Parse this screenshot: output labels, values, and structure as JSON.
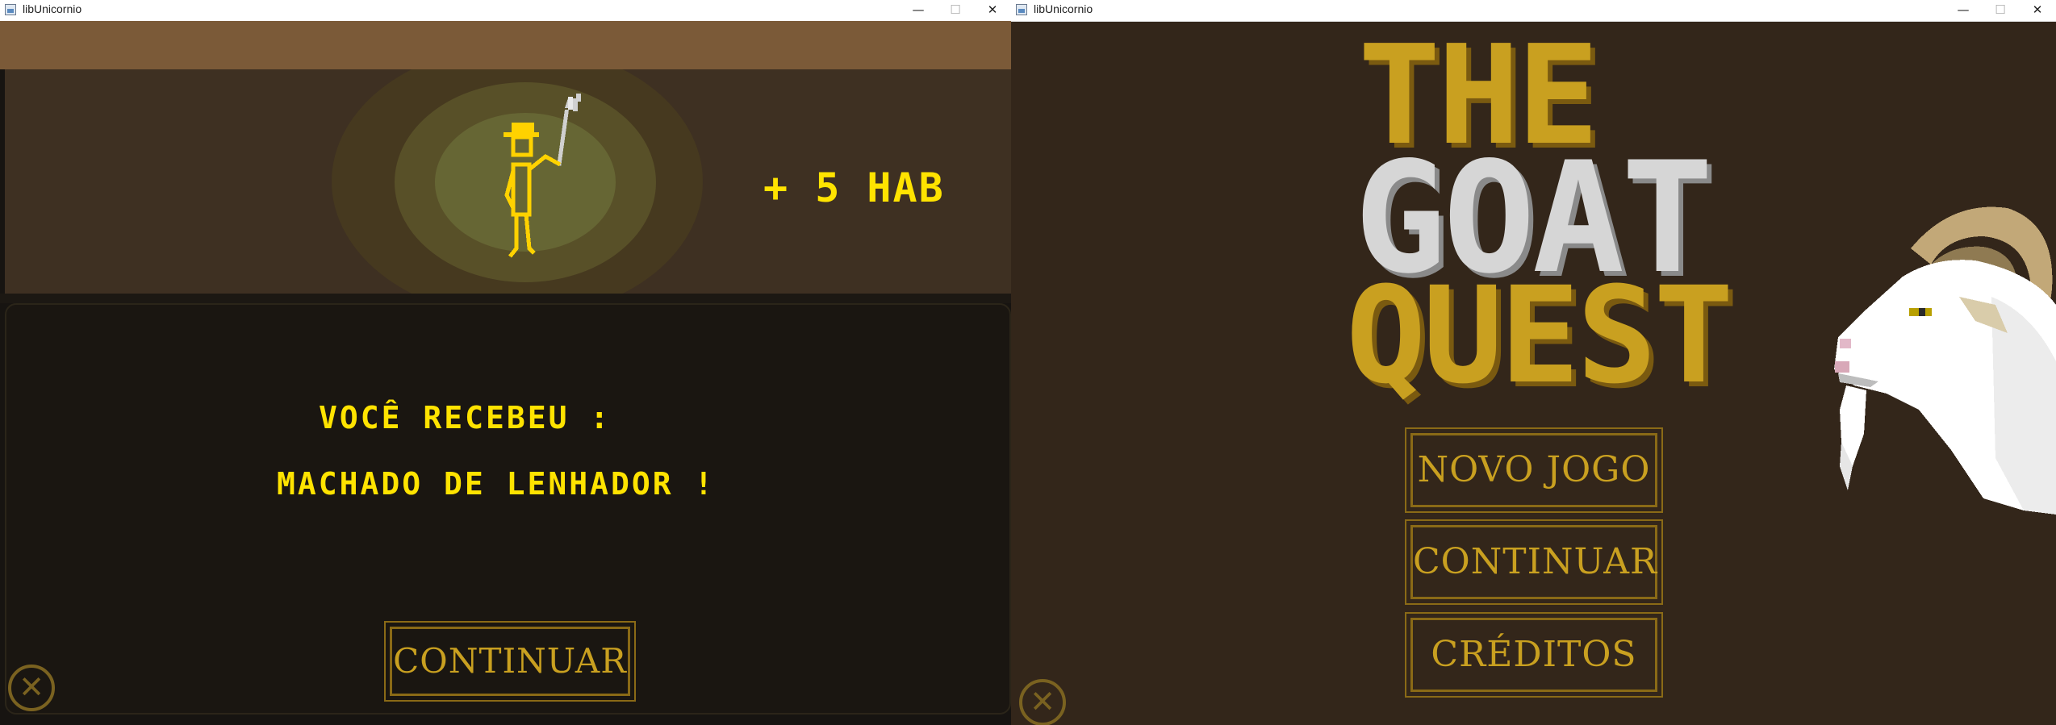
{
  "left_window": {
    "title": "libUnicornio",
    "controls": {
      "minimize": "—",
      "maximize": "☐",
      "close": "✕"
    },
    "reward": {
      "bonus": "+ 5 HAB"
    },
    "dialog": {
      "line1": "VOCÊ RECEBEU :",
      "line2": "MACHADO DE LENHADOR !"
    },
    "continue_label": "CONTINUAR",
    "close_icon_glyph": "✕"
  },
  "right_window": {
    "title": "libUnicornio",
    "controls": {
      "minimize": "—",
      "maximize": "☐",
      "close": "✕"
    },
    "game_title": {
      "the": "THE",
      "goat": "GOAT",
      "quest": "QUEST"
    },
    "menu": {
      "new_game": "NOVO JOGO",
      "continue": "CONTINUAR",
      "credits": "CRÉDITOS"
    },
    "close_icon_glyph": "✕"
  },
  "icons": [
    "app-window-icon",
    "lumberjack-figure",
    "goat-head-art",
    "circle-x-icon"
  ],
  "colors": {
    "text_yellow": "#ffe300",
    "gold": "#c9a020",
    "gold_dark": "#8a6a16",
    "silver": "#d6d6d6",
    "bg_brown": "#33261a"
  }
}
